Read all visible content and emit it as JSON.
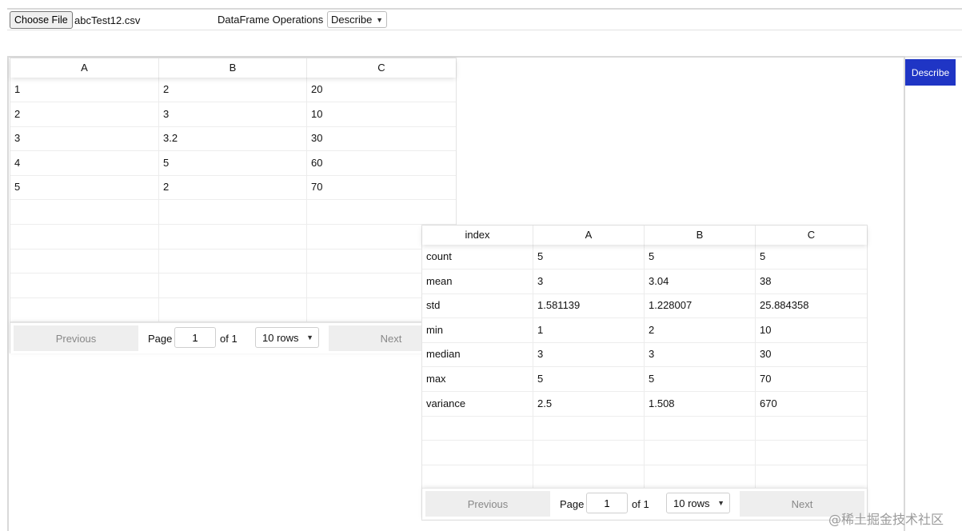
{
  "toolbar": {
    "choose_file_label": "Choose File",
    "file_name": "abcTest12.csv",
    "operations_label": "DataFrame Operations",
    "operation_selected": "Describe"
  },
  "describe_button": "Describe",
  "data_table": {
    "columns": [
      "A",
      "B",
      "C"
    ],
    "rows": [
      [
        "1",
        "2",
        "20"
      ],
      [
        "2",
        "3",
        "10"
      ],
      [
        "3",
        "3.2",
        "30"
      ],
      [
        "4",
        "5",
        "60"
      ],
      [
        "5",
        "2",
        "70"
      ]
    ],
    "pager": {
      "previous": "Previous",
      "page_label": "Page",
      "page_value": "1",
      "of_label": "of 1",
      "rows_option": "10 rows",
      "next": "Next"
    }
  },
  "describe_table": {
    "columns": [
      "index",
      "A",
      "B",
      "C"
    ],
    "rows": [
      [
        "count",
        "5",
        "5",
        "5"
      ],
      [
        "mean",
        "3",
        "3.04",
        "38"
      ],
      [
        "std",
        "1.581139",
        "1.228007",
        "25.884358"
      ],
      [
        "min",
        "1",
        "2",
        "10"
      ],
      [
        "median",
        "3",
        "3",
        "30"
      ],
      [
        "max",
        "5",
        "5",
        "70"
      ],
      [
        "variance",
        "2.5",
        "1.508",
        "670"
      ]
    ],
    "pager": {
      "previous": "Previous",
      "page_label": "Page",
      "page_value": "1",
      "of_label": "of 1",
      "rows_option": "10 rows",
      "next": "Next"
    }
  },
  "watermark": "@稀土掘金技术社区",
  "colors": {
    "accent": "#1f35c5"
  }
}
